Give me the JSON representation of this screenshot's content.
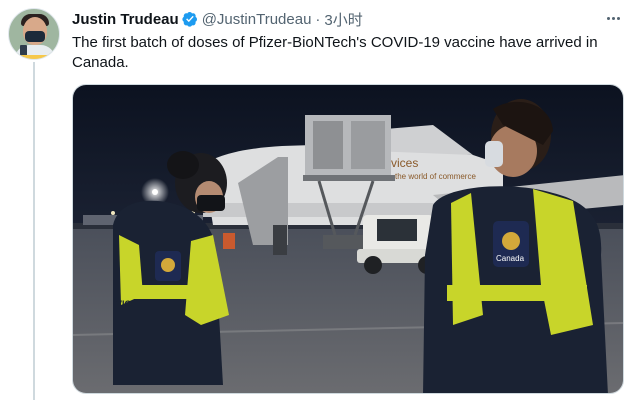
{
  "tweet": {
    "display_name": "Justin Trudeau",
    "handle": "@JustinTrudeau",
    "separator": "·",
    "time": "3小时",
    "text": "The first batch of doses of Pfizer-BioNTech's COVID-19 vaccine have arrived in Canada."
  },
  "photo": {
    "plane_livery_text_1": "vices",
    "plane_livery_text_2": "the world of commerce",
    "officer_patch_text": "Canada",
    "vest_text": "VICE"
  },
  "icons": {
    "verified": "verified-badge-icon",
    "more": "more-options-icon"
  },
  "colors": {
    "verified_blue": "#1d9bf0",
    "text_primary": "#0f1419",
    "text_secondary": "#536471",
    "thread_line": "#cfd9de",
    "vest_yellow": "#c8d52a"
  }
}
